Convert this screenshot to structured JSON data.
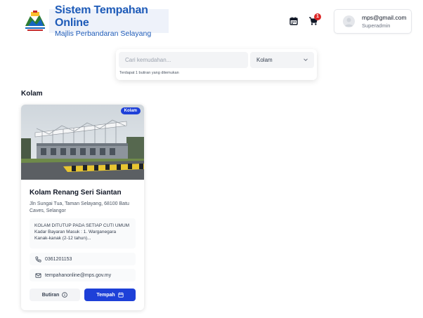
{
  "header": {
    "title": "Sistem Tempahan Online",
    "subtitle": "Majlis Perbandaran Selayang",
    "cart_count": "1",
    "user": {
      "email": "mps@gmail.com",
      "role": "Superadmin"
    }
  },
  "search": {
    "placeholder": "Cari kemudahan...",
    "category_selected": "Kolam",
    "result_text": "Terdapat 1 butiran yang ditemukan"
  },
  "section": {
    "title": "Kolam"
  },
  "facilities": [
    {
      "badge": "Kolam",
      "name": "Kolam Renang Seri Siantan",
      "address": "Jln Sungai Tua, Taman Selayang, 68100 Batu Caves, Selangor",
      "notice": "KOLAM DITUTUP PADA SETIAP CUTI UMUM Kadar Bayaran Masuk : 1. Warganegara Kanak-kanak (2-12 tahun)...",
      "phone": "0361201153",
      "email": "tempahanonline@mps.gov.my",
      "detail_label": "Butiran",
      "book_label": "Tempah"
    }
  ],
  "colors": {
    "primary": "#1e40d8",
    "brand": "#1e5bb8",
    "badge_red": "#dc2626"
  }
}
